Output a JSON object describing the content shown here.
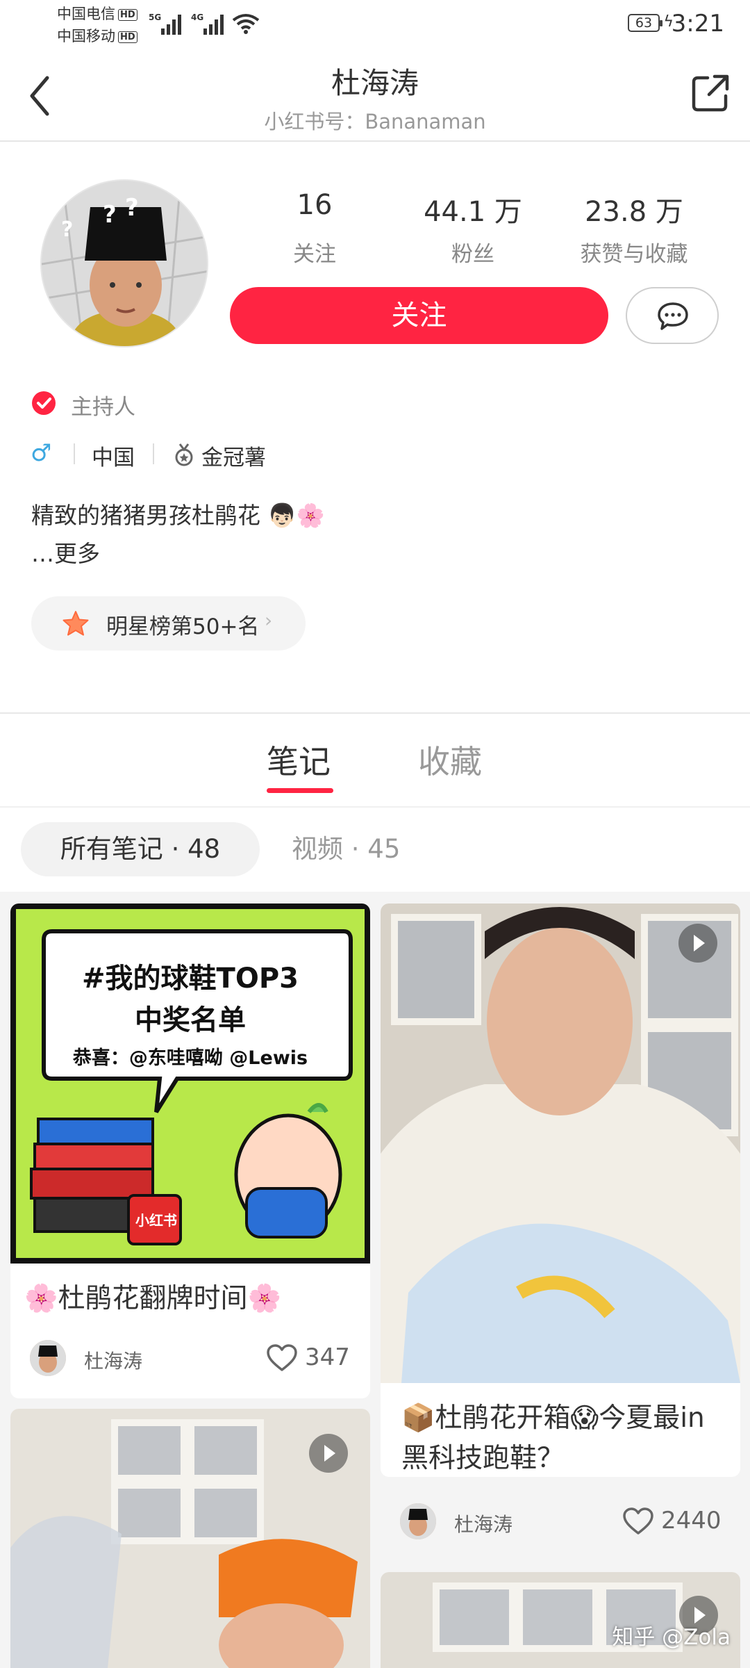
{
  "status_bar": {
    "carrier1": "中国电信",
    "carrier2": "中国移动",
    "hd": "HD",
    "net1": "5G",
    "net2": "4G",
    "battery": "63",
    "time": "3:21"
  },
  "header": {
    "title": "杜海涛",
    "subtitle": "小红书号：Bananaman",
    "back_icon": "chevron-left-icon",
    "share_icon": "share-external-icon"
  },
  "profile": {
    "stats": [
      {
        "value": "16",
        "label": "关注"
      },
      {
        "value": "44.1 万",
        "label": "粉丝"
      },
      {
        "value": "23.8 万",
        "label": "获赞与收藏"
      }
    ],
    "follow_label": "关注",
    "message_icon": "chat-bubble-icon",
    "verified_label": "主持人",
    "gender": "♂",
    "location": "中国",
    "medal_label": "金冠薯",
    "bio": "精致的猪猪男孩杜鹃花 👦🏻🌸",
    "more_label": "…更多",
    "rank_label": "明星榜第50+名",
    "accent_color": "#ff2442"
  },
  "tabs": [
    {
      "label": "笔记",
      "active": true
    },
    {
      "label": "收藏",
      "active": false
    }
  ],
  "filters": [
    {
      "label": "所有笔记 · 48",
      "active": true
    },
    {
      "label": "视频 · 45",
      "active": false
    }
  ],
  "notes": {
    "card1": {
      "poster_line1": "#我的球鞋TOP3",
      "poster_line2": "中奖名单",
      "poster_line3": "恭喜：@东哇嘻呦 @Lewis",
      "title": "🌸杜鹃花翻牌时间🌸",
      "author": "杜海涛",
      "likes": "347"
    },
    "card2": {
      "title": "📦杜鹃花开箱😱今夏最in黑科技跑鞋？",
      "author": "杜海涛",
      "likes": "2440"
    }
  },
  "watermark": "知乎 @Zola"
}
